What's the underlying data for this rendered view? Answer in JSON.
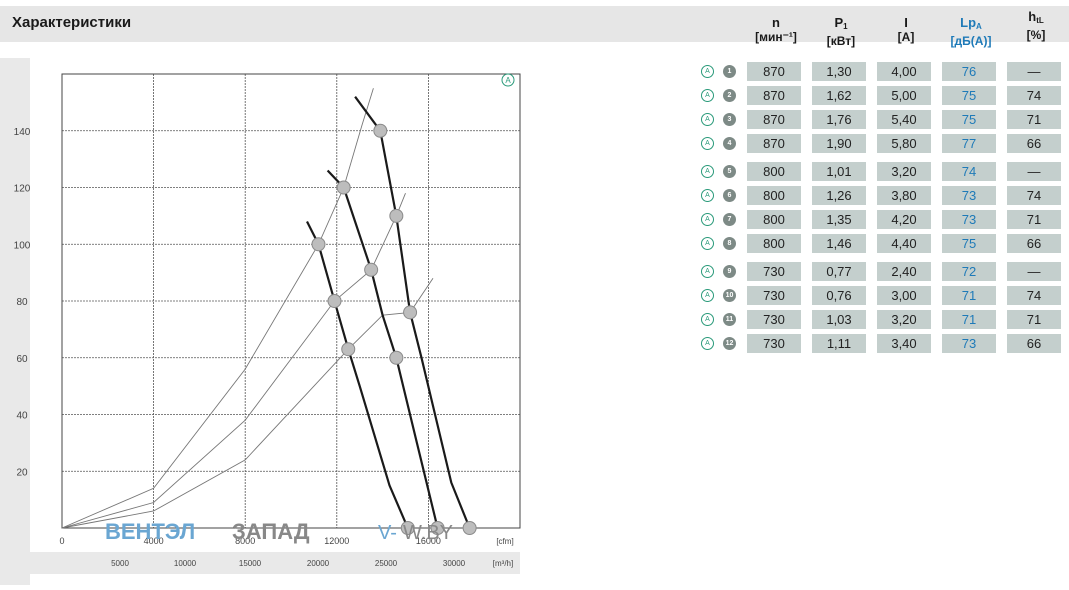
{
  "title": "Характеристики",
  "columns": [
    {
      "sym": "n",
      "unit": "[мин⁻¹]"
    },
    {
      "sym": "P",
      "sub": "1",
      "unit": "[кВт]"
    },
    {
      "sym": "I",
      "unit": "[A]"
    },
    {
      "sym": "Lp",
      "sub": "A",
      "unit": "[дБ(A)]"
    },
    {
      "sym": "h",
      "sub": "tL",
      "unit": "[%]"
    }
  ],
  "rows": [
    {
      "no": "1",
      "n": "870",
      "p": "1,30",
      "i": "4,00",
      "lp": "76",
      "h": "—"
    },
    {
      "no": "2",
      "n": "870",
      "p": "1,62",
      "i": "5,00",
      "lp": "75",
      "h": "74"
    },
    {
      "no": "3",
      "n": "870",
      "p": "1,76",
      "i": "5,40",
      "lp": "75",
      "h": "71"
    },
    {
      "no": "4",
      "n": "870",
      "p": "1,90",
      "i": "5,80",
      "lp": "77",
      "h": "66"
    },
    {
      "no": "5",
      "n": "800",
      "p": "1,01",
      "i": "3,20",
      "lp": "74",
      "h": "—"
    },
    {
      "no": "6",
      "n": "800",
      "p": "1,26",
      "i": "3,80",
      "lp": "73",
      "h": "74"
    },
    {
      "no": "7",
      "n": "800",
      "p": "1,35",
      "i": "4,20",
      "lp": "73",
      "h": "71"
    },
    {
      "no": "8",
      "n": "800",
      "p": "1,46",
      "i": "4,40",
      "lp": "75",
      "h": "66"
    },
    {
      "no": "9",
      "n": "730",
      "p": "0,77",
      "i": "2,40",
      "lp": "72",
      "h": "—"
    },
    {
      "no": "10",
      "n": "730",
      "p": "0,76",
      "i": "3,00",
      "lp": "71",
      "h": "74"
    },
    {
      "no": "11",
      "n": "730",
      "p": "1,03",
      "i": "3,20",
      "lp": "71",
      "h": "71"
    },
    {
      "no": "12",
      "n": "730",
      "p": "1,11",
      "i": "3,40",
      "lp": "73",
      "h": "66"
    }
  ],
  "colors": {
    "cell_bg": "#c4cfcd",
    "accent_blue": "#1e7ab8",
    "badge": "#7d8a86",
    "circle_green": "#2a9a7a"
  },
  "chart_data": {
    "type": "line",
    "corner_badge": "A",
    "x_unit": "[cfm]",
    "x2_unit": "[m³/h]",
    "x_ticks": [
      "0",
      "4000",
      "8000",
      "12000",
      "16000"
    ],
    "x2_ticks": [
      "5000",
      "10000",
      "15000",
      "20000",
      "25000",
      "30000"
    ],
    "y_ticks": [
      "20",
      "40",
      "60",
      "80",
      "100",
      "120",
      "140"
    ],
    "xlim": [
      0,
      20000
    ],
    "ylim": [
      0,
      160
    ],
    "grid": true,
    "fan_curves": [
      {
        "name": "870",
        "points": [
          [
            12800,
            152
          ],
          [
            13900,
            140
          ],
          [
            14600,
            110
          ],
          [
            15200,
            76
          ],
          [
            15700,
            60
          ],
          [
            17000,
            16
          ],
          [
            17800,
            0
          ]
        ]
      },
      {
        "name": "800",
        "points": [
          [
            11600,
            126
          ],
          [
            12300,
            120
          ],
          [
            13500,
            91
          ],
          [
            14000,
            75
          ],
          [
            14600,
            60
          ],
          [
            15500,
            30
          ],
          [
            16400,
            0
          ]
        ]
      },
      {
        "name": "730",
        "points": [
          [
            10700,
            108
          ],
          [
            11200,
            100
          ],
          [
            11900,
            80
          ],
          [
            12500,
            63
          ],
          [
            13000,
            50
          ],
          [
            14300,
            15
          ],
          [
            15100,
            0
          ]
        ]
      }
    ],
    "system_curves": [
      {
        "points": [
          [
            0,
            0
          ],
          [
            4000,
            14
          ],
          [
            8000,
            56
          ],
          [
            11200,
            100
          ],
          [
            12300,
            120
          ],
          [
            13100,
            142
          ],
          [
            13600,
            155
          ]
        ]
      },
      {
        "points": [
          [
            0,
            0
          ],
          [
            4000,
            9
          ],
          [
            8000,
            38
          ],
          [
            11900,
            80
          ],
          [
            13500,
            91
          ],
          [
            14600,
            110
          ],
          [
            15000,
            118
          ]
        ]
      },
      {
        "points": [
          [
            0,
            0
          ],
          [
            4000,
            6
          ],
          [
            8000,
            24
          ],
          [
            12500,
            63
          ],
          [
            14000,
            75
          ],
          [
            15200,
            76
          ],
          [
            16200,
            88
          ]
        ]
      }
    ],
    "operating_points": [
      {
        "x": 13900,
        "y": 140
      },
      {
        "x": 14600,
        "y": 110
      },
      {
        "x": 15200,
        "y": 76
      },
      {
        "x": 17800,
        "y": 0
      },
      {
        "x": 12300,
        "y": 120
      },
      {
        "x": 13500,
        "y": 91
      },
      {
        "x": 14600,
        "y": 60
      },
      {
        "x": 16400,
        "y": 0
      },
      {
        "x": 11200,
        "y": 100
      },
      {
        "x": 11900,
        "y": 80
      },
      {
        "x": 12500,
        "y": 63
      },
      {
        "x": 15100,
        "y": 0
      }
    ]
  },
  "watermark": {
    "part1": "ВЕНТЭЛ",
    "part2": "ЗАПАД",
    "part3": "V-",
    "part4": "W.BY"
  }
}
